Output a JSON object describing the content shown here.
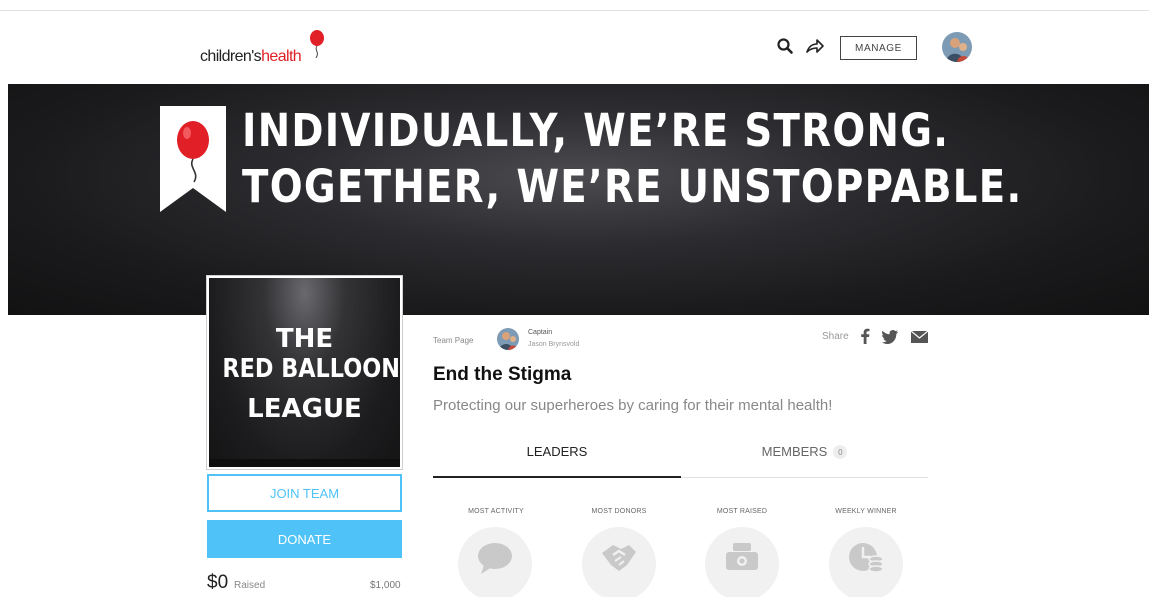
{
  "header": {
    "logo": {
      "prefix": "children's",
      "brand": "health"
    },
    "manage_label": "MANAGE"
  },
  "hero": {
    "line1": "INDIVIDUALLY, WE’RE STRONG.",
    "line2": "TOGETHER, WE’RE UNSTOPPABLE."
  },
  "team_card": {
    "line1": "THE",
    "line2": "RED BALLOON",
    "line3": "LEAGUE"
  },
  "actions": {
    "join_label": "JOIN TEAM",
    "donate_label": "DONATE"
  },
  "fundraising": {
    "raised": "$0",
    "raised_label": "Raised",
    "goal": "$1,000"
  },
  "team": {
    "page_label": "Team Page",
    "captain_label": "Captain",
    "captain_name": "Jason Brynsvold",
    "share_label": "Share",
    "title": "End the Stigma",
    "tagline": "Protecting our superheroes by caring for their mental health!"
  },
  "tabs": [
    {
      "label": "LEADERS",
      "active": true
    },
    {
      "label": "MEMBERS",
      "count": "0",
      "active": false
    }
  ],
  "leaderboard": [
    {
      "label": "MOST ACTIVITY",
      "icon": "chat-icon"
    },
    {
      "label": "MOST DONORS",
      "icon": "handshake-icon"
    },
    {
      "label": "MOST RAISED",
      "icon": "money-icon"
    },
    {
      "label": "WEEKLY WINNER",
      "icon": "clock-coins-icon"
    }
  ],
  "colors": {
    "accent": "#4fc3f7",
    "brand_red": "#e01f26",
    "hero_bg": "#1a1a1c"
  }
}
